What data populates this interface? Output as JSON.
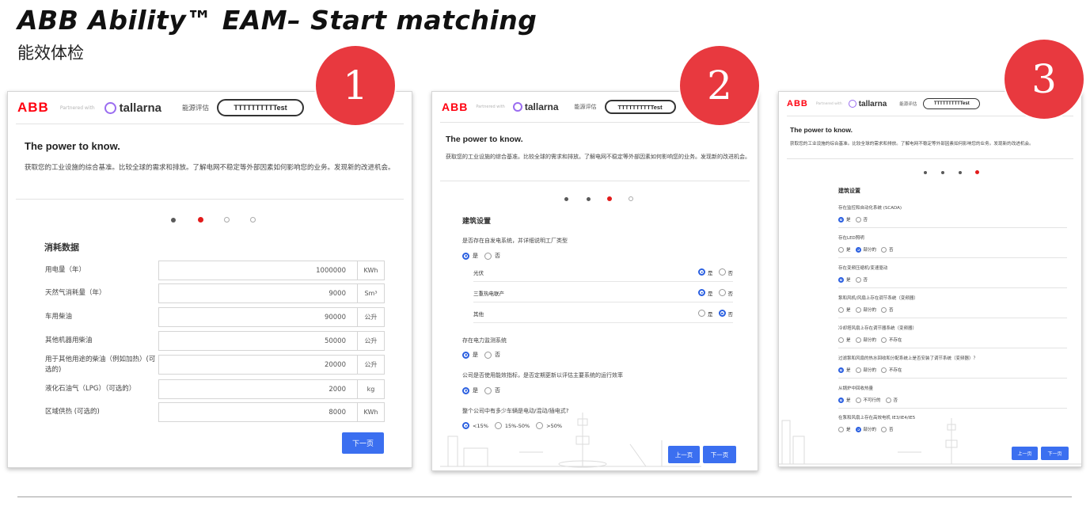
{
  "slide": {
    "title": "ABB Ability™ EAM– Start matching",
    "subtitle": "能效体检"
  },
  "header": {
    "abb_logo": "ABB",
    "partnered": "Partnered with",
    "tallarna": "tallarna",
    "assess": "能源评估",
    "pill": "TTTTTTTTTTest"
  },
  "hero": {
    "title": "The power to know.",
    "desc": "获取您的工业设施的综合基准。比较全球的需求和排放。了解电网不稳定等外部因素如何影响您的业务。发现新的改进机会。"
  },
  "badges": [
    "1",
    "2",
    "3"
  ],
  "panel1": {
    "section": "消耗数据",
    "fields": [
      {
        "label": "用电量（年）",
        "value": "1000000",
        "unit": "KWh"
      },
      {
        "label": "天然气消耗量（年）",
        "value": "9000",
        "unit": "Sm³"
      },
      {
        "label": "车用柴油",
        "value": "90000",
        "unit": "公升"
      },
      {
        "label": "其他机器用柴油",
        "value": "50000",
        "unit": "公升"
      },
      {
        "label": "用于其他用途的柴油（例如加热）(可选的)",
        "value": "20000",
        "unit": "公升"
      },
      {
        "label": "液化石油气（LPG）（可选的）",
        "value": "2000",
        "unit": "kg"
      },
      {
        "label": "区域供热 (可选的)",
        "value": "8000",
        "unit": "KWh"
      }
    ],
    "next": "下一页"
  },
  "panel2": {
    "section": "建筑设置",
    "q1": "是否存在自发电系统，并详细说明工厂类型",
    "yes": "是",
    "no": "否",
    "subs": [
      "光伏",
      "三重热电联产",
      "其他"
    ],
    "q2": "存在电力监测系统",
    "q3": "公司是否使用能效指标，是否定期更新以评估主要系统的运行效率",
    "q4": "整个公司中有多少车辆是电动/混动/插电式?",
    "q4_opts": [
      "<15%",
      "15%-50%",
      ">50%"
    ],
    "prev": "上一页",
    "next": "下一页"
  },
  "panel3": {
    "section": "建筑设置",
    "yes": "是",
    "no": "否",
    "partial": "部分的",
    "none": "不存在",
    "na": "不可行的",
    "questions": [
      "存在监控和自动化系统 (SCADA)",
      "存在LED照明",
      "存在变频压缩机/变速驱动",
      "泵和风机/风扇上存在调节系统（变频器）",
      "冷却塔风扇上存在调节器系统（变频器）",
      "过滤泵和风扇的热水回收和分配系统上是否安装了调节系统（变频器）？",
      "从锅炉中回收热量",
      "在泵和风扇上存在高效电机 IE3/IE4/IE5"
    ],
    "prev": "上一页",
    "next": "下一页"
  },
  "colors": {
    "abb_red": "#ff000f",
    "badge_red": "#e8393f",
    "primary_blue": "#3b6ff0",
    "tallarna_purple": "#9a6cf0"
  }
}
